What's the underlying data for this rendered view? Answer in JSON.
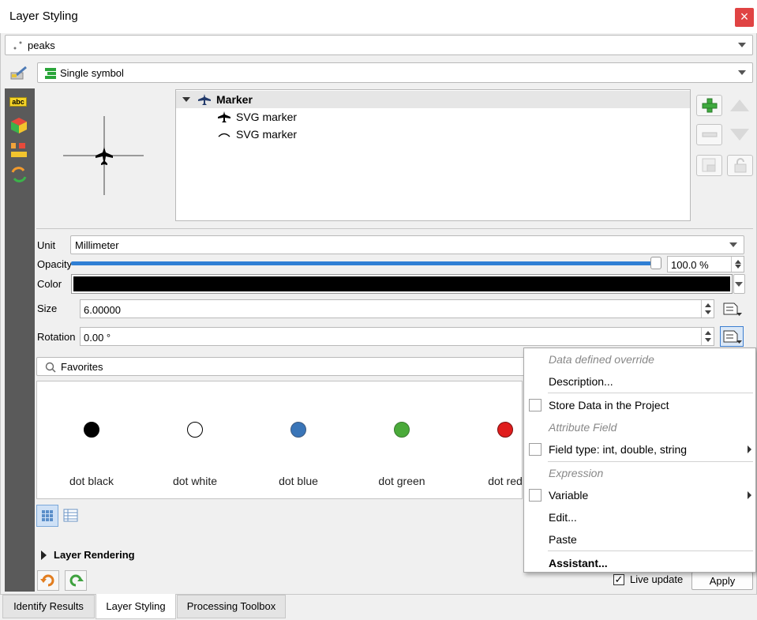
{
  "window": {
    "title": "Layer Styling",
    "close_icon": "×"
  },
  "layer_select": {
    "value": "peaks"
  },
  "renderer": {
    "value": "Single symbol"
  },
  "sidebar": {
    "icons": [
      "label-icon",
      "3d-view-icon",
      "diagram-icon",
      "history-icon"
    ],
    "label_icon_text": "abc"
  },
  "symbol_tree": {
    "root": {
      "label": "Marker"
    },
    "layers": [
      {
        "label": "SVG marker"
      },
      {
        "label": "SVG marker"
      }
    ]
  },
  "properties": {
    "unit_label": "Unit",
    "unit_value": "Millimeter",
    "opacity_label": "Opacity",
    "opacity_value": "100.0 %",
    "opacity_fraction": 1.0,
    "color_label": "Color",
    "color_value": "#000000",
    "size_label": "Size",
    "size_value": "6.00000",
    "rotation_label": "Rotation",
    "rotation_value": "0.00 °"
  },
  "search": {
    "value": "Favorites"
  },
  "symbols": [
    {
      "label": "dot  black",
      "fill": "#000000",
      "stroke": "#000000"
    },
    {
      "label": "dot  white",
      "fill": "#ffffff",
      "stroke": "#000000"
    },
    {
      "label": "dot blue",
      "fill": "#3a75b8",
      "stroke": "#3d5a80"
    },
    {
      "label": "dot green",
      "fill": "#4aaa3a",
      "stroke": "#3a7a30"
    },
    {
      "label": "dot red",
      "fill": "#e01d1d",
      "stroke": "#7a1010"
    }
  ],
  "layer_rendering": {
    "label": "Layer Rendering"
  },
  "live_update": {
    "label": "Live update",
    "checked": "✓"
  },
  "apply_button": {
    "label": "Apply"
  },
  "context_menu": {
    "header_ddo": "Data defined override",
    "description": "Description...",
    "store_data": "Store Data in the Project",
    "header_attribute": "Attribute Field",
    "field_type": "Field type: int, double, string",
    "header_expression": "Expression",
    "variable": "Variable",
    "edit": "Edit...",
    "paste": "Paste",
    "assistant": "Assistant..."
  },
  "bottom_tabs": [
    {
      "label": "Identify Results"
    },
    {
      "label": "Layer Styling"
    },
    {
      "label": "Processing Toolbox"
    }
  ]
}
